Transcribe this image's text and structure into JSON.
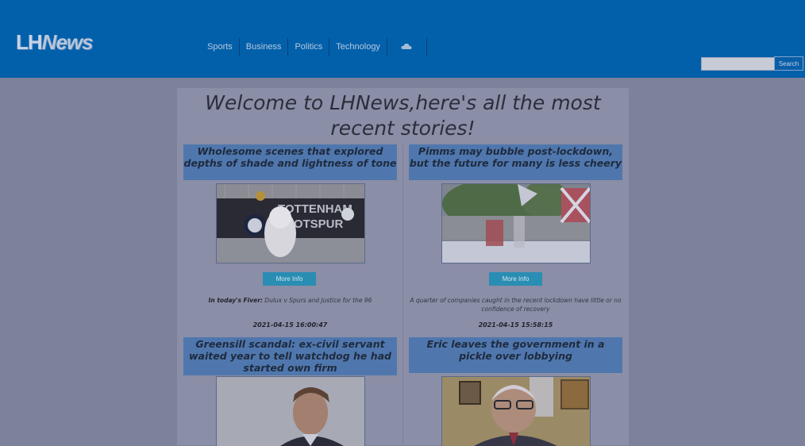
{
  "header": {
    "logo_lh": "LH",
    "logo_news": "News",
    "nav": [
      "Sports",
      "Business",
      "Politics",
      "Technology"
    ],
    "weather_icon": "cloud-icon",
    "search_placeholder": "",
    "search_button": "Search"
  },
  "main": {
    "welcome": "Welcome to LHNews,here's all the most recent stories!",
    "articles": [
      {
        "title": "Wholesome scenes that explored depths of shade and lightness of tone",
        "button": "More Info",
        "summary_bold": "In today's Fiver:",
        "summary": " Dulux v Spurs and Justice for the 96",
        "timestamp": "2021-04-15 16:00:47",
        "image": "dog-at-tottenham-stadium"
      },
      {
        "title": "Pimms may bubble post-lockdown, but the future for many is less cheery",
        "button": "More Info",
        "summary_bold": "",
        "summary": "A quarter of companies caught in the recent lockdown have little or no confidence of recovery",
        "timestamp": "2021-04-15 15:58:15",
        "image": "pimms-garden-table"
      },
      {
        "title": "Greensill scandal: ex-civil servant waited year to tell watchdog he had started own firm",
        "image": "man-portrait"
      },
      {
        "title": "Eric leaves the government in a pickle over lobbying",
        "image": "eric-pickles-portrait"
      }
    ]
  },
  "colors": {
    "header_bg": "#0260aa",
    "page_bg": "#7d829b",
    "card_title_bg": "#4f77ae",
    "button_bg": "#2a8db3"
  }
}
